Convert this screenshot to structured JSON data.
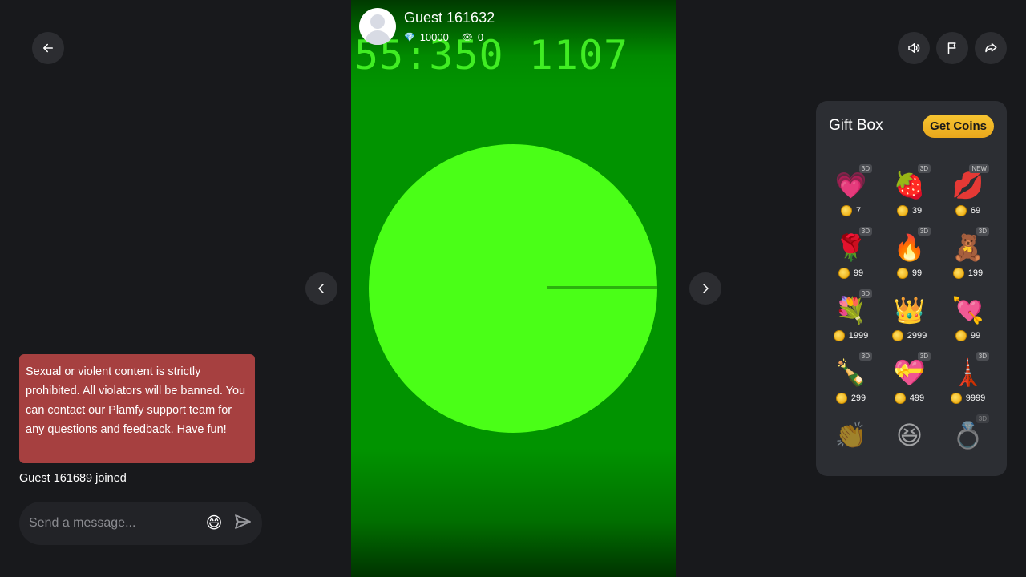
{
  "host": {
    "name": "Guest 161632",
    "diamonds": "10000",
    "viewers": "0"
  },
  "stream": {
    "overlay_text": "55:350 1107"
  },
  "chat": {
    "notice": "Sexual or violent content is strictly prohibited. All violators will be banned. You can contact our Plamfy support team for any questions and feedback. Have fun!",
    "joined_message": "Guest 161689 joined",
    "input_placeholder": "Send a message...",
    "emoji_icon": "😄"
  },
  "giftbox": {
    "title": "Gift Box",
    "get_coins_label": "Get Coins",
    "gifts": [
      {
        "icon": "follow-me-heart",
        "glyph": "💗",
        "badge": "3D",
        "price": "7"
      },
      {
        "icon": "strawberry",
        "glyph": "🍓",
        "badge": "3D",
        "price": "39"
      },
      {
        "icon": "lips",
        "glyph": "💋",
        "badge": "NEW",
        "price": "69"
      },
      {
        "icon": "rose",
        "glyph": "🌹",
        "badge": "3D",
        "price": "99"
      },
      {
        "icon": "fire",
        "glyph": "🔥",
        "badge": "3D",
        "price": "99"
      },
      {
        "icon": "teddy-bear",
        "glyph": "🧸",
        "badge": "3D",
        "price": "199"
      },
      {
        "icon": "rose-bouquet",
        "glyph": "💐",
        "badge": "3D",
        "price": "1999"
      },
      {
        "icon": "tiara",
        "glyph": "👑",
        "badge": "",
        "price": "2999"
      },
      {
        "icon": "arrow-heart",
        "glyph": "💘",
        "badge": "",
        "price": "99"
      },
      {
        "icon": "champagne",
        "glyph": "🍾",
        "badge": "3D",
        "price": "299"
      },
      {
        "icon": "heart-gift-box",
        "glyph": "💝",
        "badge": "3D",
        "price": "499"
      },
      {
        "icon": "eiffel-tower",
        "glyph": "🗼",
        "badge": "3D",
        "price": "9999"
      },
      {
        "icon": "clapping-hands",
        "glyph": "👏",
        "badge": "",
        "price": ""
      },
      {
        "icon": "laughing-face",
        "glyph": "😆",
        "badge": "",
        "price": ""
      },
      {
        "icon": "diamond-ring",
        "glyph": "💍",
        "badge": "3D",
        "price": ""
      }
    ]
  },
  "colors": {
    "background": "#18191c",
    "notice_bg": "#a64040",
    "panel_bg": "#2c2e33",
    "accent_gold": "#f7c531",
    "stream_green": "#4aff17"
  }
}
